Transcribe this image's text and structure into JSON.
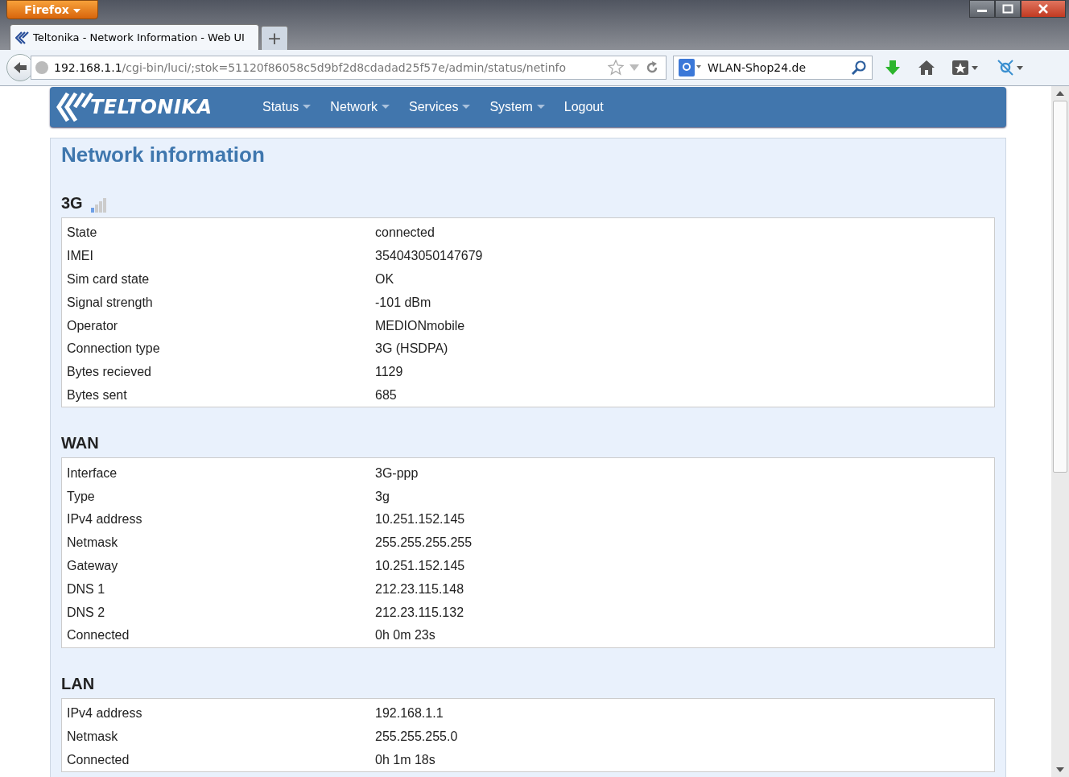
{
  "browser": {
    "menu_button": "Firefox",
    "menu_caret": true,
    "tab": {
      "title": "Teltonika - Network Information - Web UI",
      "selected": true
    },
    "new_tab": "+",
    "url": {
      "host": "192.168.1.1",
      "path": "/cgi-bin/luci/;stok=51120f86058c5d9bf2d8cdadad25f57e/admin/status/netinfo"
    },
    "search": "WLAN-Shop24.de"
  },
  "nav": {
    "brand": "TELTONIKA",
    "items": [
      {
        "label": "Status",
        "dropdown": true
      },
      {
        "label": "Network",
        "dropdown": true
      },
      {
        "label": "Services",
        "dropdown": true
      },
      {
        "label": "System",
        "dropdown": true
      },
      {
        "label": "Logout",
        "dropdown": false
      }
    ]
  },
  "page_title": "Network information",
  "sections": [
    {
      "title": "3G",
      "signal_icon": true,
      "rows": [
        {
          "label": "State",
          "value": "connected"
        },
        {
          "label": "IMEI",
          "value": "354043050147679"
        },
        {
          "label": "Sim card state",
          "value": "OK"
        },
        {
          "label": "Signal strength",
          "value": "-101 dBm"
        },
        {
          "label": "Operator",
          "value": "MEDIONmobile"
        },
        {
          "label": "Connection type",
          "value": "3G (HSDPA)"
        },
        {
          "label": "Bytes recieved",
          "value": "1129"
        },
        {
          "label": "Bytes sent",
          "value": "685"
        }
      ]
    },
    {
      "title": "WAN",
      "signal_icon": false,
      "rows": [
        {
          "label": "Interface",
          "value": "3G-ppp"
        },
        {
          "label": "Type",
          "value": "3g"
        },
        {
          "label": "IPv4 address",
          "value": "10.251.152.145"
        },
        {
          "label": "Netmask",
          "value": "255.255.255.255"
        },
        {
          "label": "Gateway",
          "value": "10.251.152.145"
        },
        {
          "label": "DNS 1",
          "value": "212.23.115.148"
        },
        {
          "label": "DNS 2",
          "value": "212.23.115.132"
        },
        {
          "label": "Connected",
          "value": "0h 0m 23s"
        }
      ]
    },
    {
      "title": "LAN",
      "signal_icon": false,
      "rows": [
        {
          "label": "IPv4 address",
          "value": "192.168.1.1"
        },
        {
          "label": "Netmask",
          "value": "255.255.255.0"
        },
        {
          "label": "Connected",
          "value": "0h 1m 18s"
        }
      ]
    }
  ]
}
